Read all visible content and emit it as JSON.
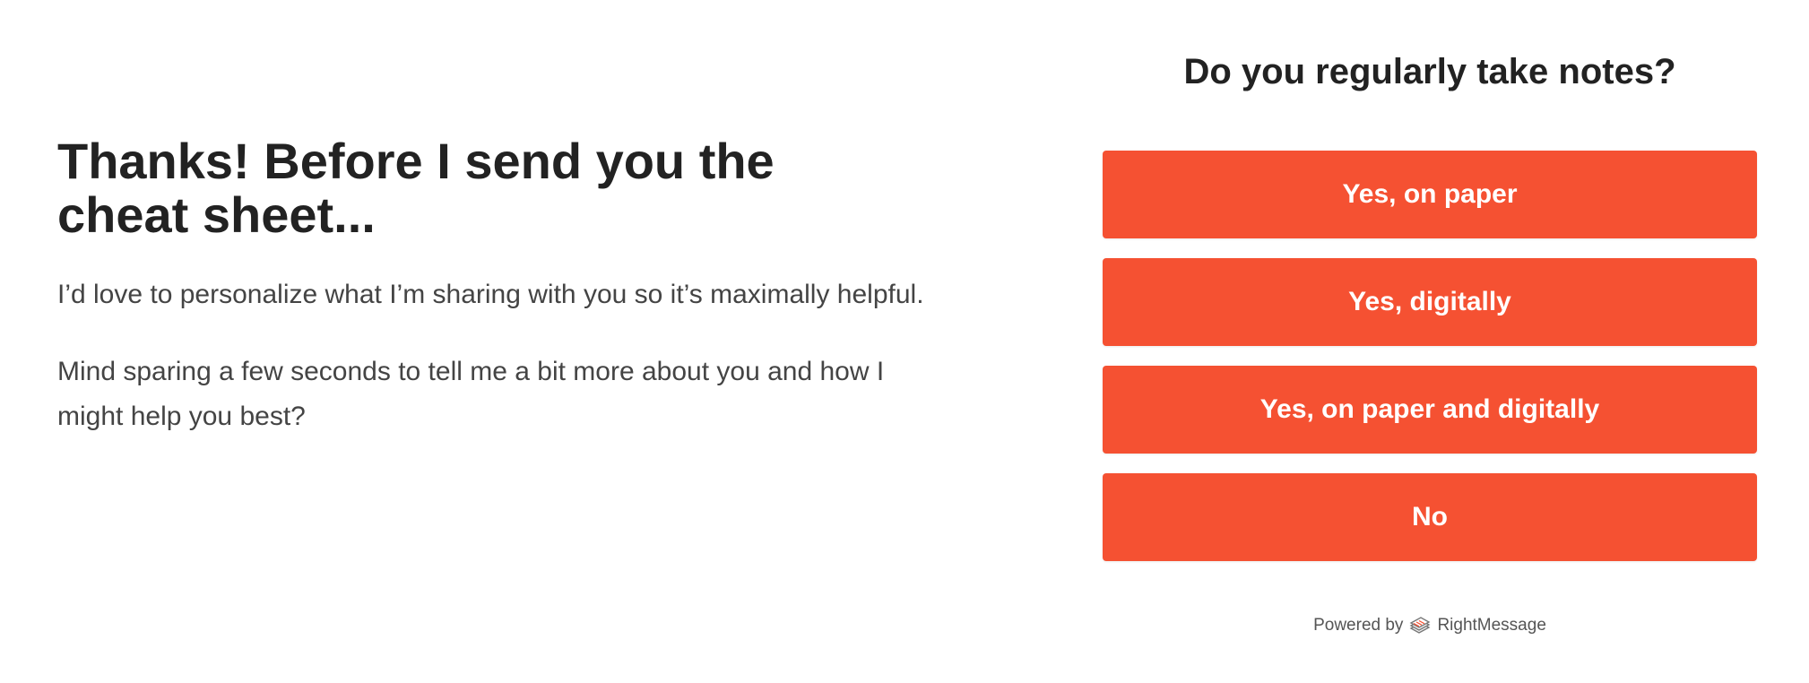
{
  "intro": {
    "headline": "Thanks! Before I send you the cheat sheet...",
    "paragraph1": "I’d love to personalize what I’m sharing with you so it’s maximally helpful.",
    "paragraph2": "Mind sparing a few seconds to tell me a bit more about you and how I might help you best?"
  },
  "survey": {
    "question": "Do you regularly take notes?",
    "answers": [
      {
        "label": "Yes, on paper"
      },
      {
        "label": "Yes, digitally"
      },
      {
        "label": "Yes, on paper and digitally"
      },
      {
        "label": "No"
      }
    ],
    "button_color": "#f55132"
  },
  "footer": {
    "powered_by": "Powered by",
    "brand": "RightMessage",
    "brand_icon": "stacked-pages-logo-icon"
  }
}
